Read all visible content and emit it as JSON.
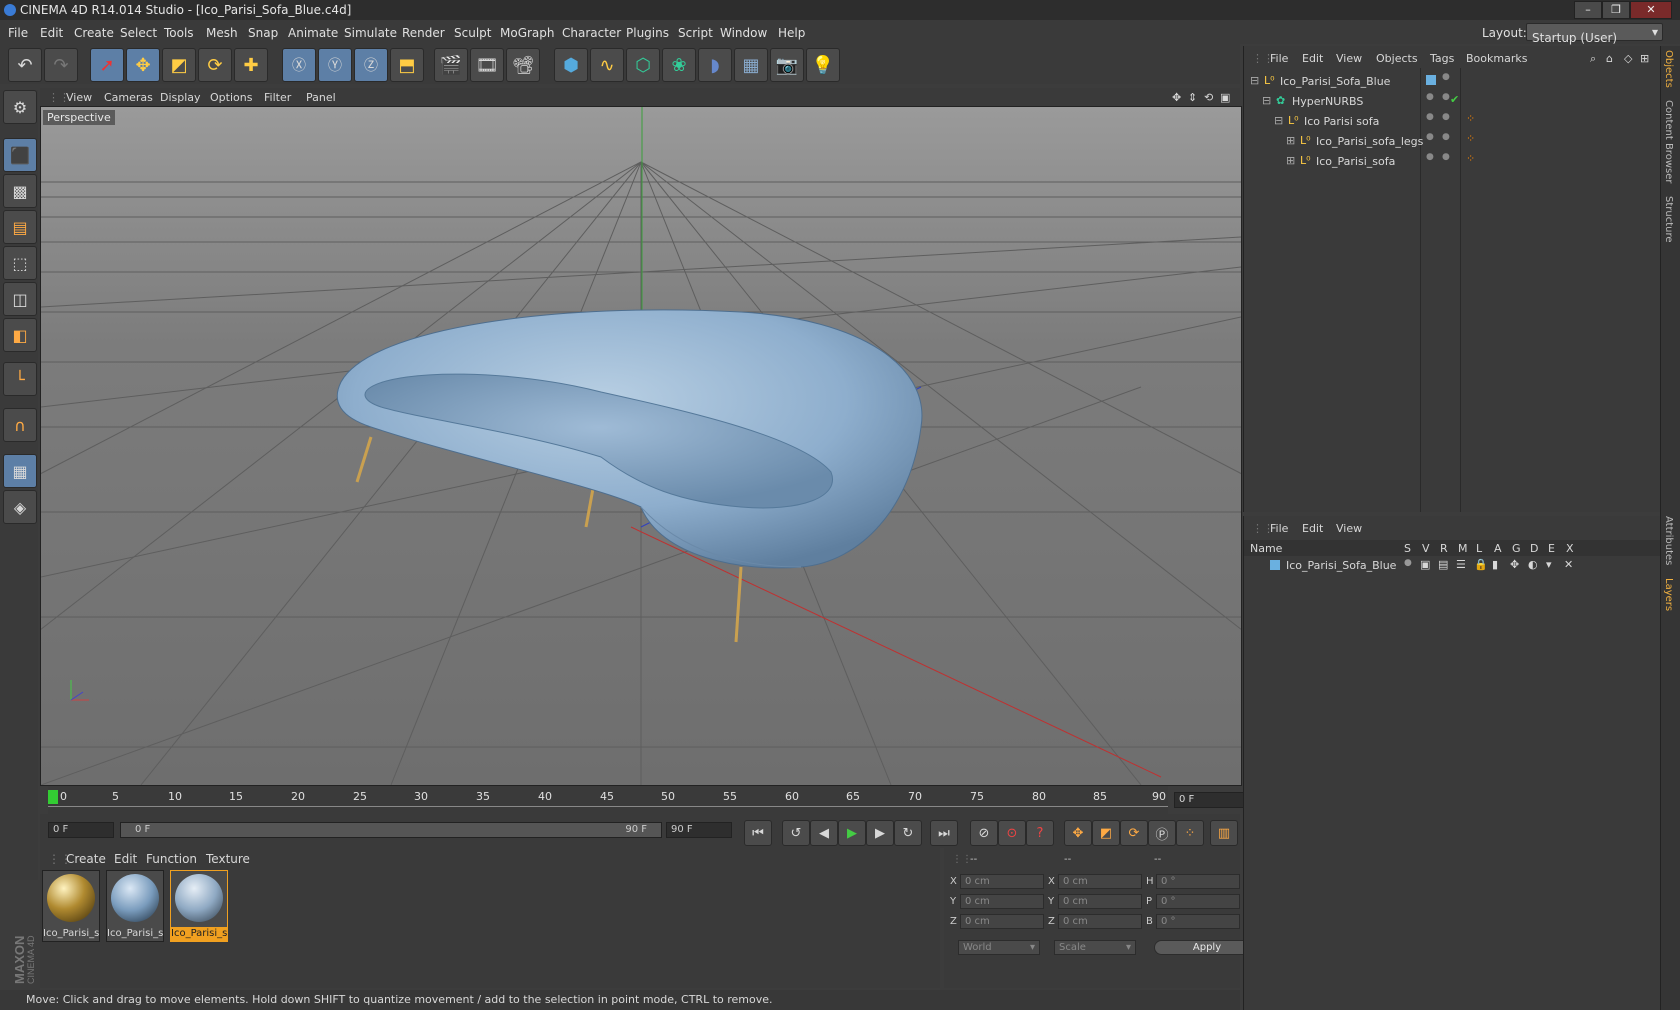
{
  "window": {
    "title": "CINEMA 4D R14.014 Studio - [Ico_Parisi_Sofa_Blue.c4d]"
  },
  "menubar": {
    "items": [
      "File",
      "Edit",
      "Create",
      "Select",
      "Tools",
      "Mesh",
      "Snap",
      "Animate",
      "Simulate",
      "Render",
      "Sculpt",
      "MoGraph",
      "Character",
      "Plugins",
      "Script",
      "Window",
      "Help"
    ],
    "layout_label": "Layout:",
    "layout_value": "Startup (User)"
  },
  "viewport": {
    "menu": [
      "View",
      "Cameras",
      "Display",
      "Options",
      "Filter",
      "Panel"
    ],
    "label": "Perspective"
  },
  "timeline": {
    "ticks": [
      "0",
      "5",
      "10",
      "15",
      "20",
      "25",
      "30",
      "35",
      "40",
      "45",
      "50",
      "55",
      "60",
      "65",
      "70",
      "75",
      "80",
      "85",
      "90"
    ],
    "current_frame": "0 F"
  },
  "transport": {
    "start": "0 F",
    "range_start": "0 F",
    "range_end": "90 F",
    "end": "90 F"
  },
  "materials": {
    "menu": [
      "Create",
      "Edit",
      "Function",
      "Texture"
    ],
    "items": [
      "Ico_Parisi_s",
      "Ico_Parisi_s",
      "Ico_Parisi_s"
    ]
  },
  "coords": {
    "headers": [
      "--",
      "--",
      "--"
    ],
    "rows": [
      {
        "a": "X",
        "av": "0 cm",
        "b": "X",
        "bv": "0 cm",
        "c": "H",
        "cv": "0 °"
      },
      {
        "a": "Y",
        "av": "0 cm",
        "b": "Y",
        "bv": "0 cm",
        "c": "P",
        "cv": "0 °"
      },
      {
        "a": "Z",
        "av": "0 cm",
        "b": "Z",
        "bv": "0 cm",
        "c": "B",
        "cv": "0 °"
      }
    ],
    "mode": "World",
    "scale": "Scale",
    "apply": "Apply"
  },
  "status": "Move: Click and drag to move elements. Hold down SHIFT to quantize movement / add to the selection in point mode, CTRL to remove.",
  "objects": {
    "menu": [
      "File",
      "Edit",
      "View",
      "Objects",
      "Tags",
      "Bookmarks"
    ],
    "tree": [
      "Ico_Parisi_Sofa_Blue",
      "HyperNURBS",
      "Ico Parisi sofa",
      "Ico_Parisi_sofa_legs",
      "Ico_Parisi_sofa"
    ]
  },
  "layers": {
    "menu": [
      "File",
      "Edit",
      "View"
    ],
    "name_header": "Name",
    "cols": [
      "S",
      "V",
      "R",
      "M",
      "L",
      "A",
      "G",
      "D",
      "E",
      "X"
    ],
    "row": "Ico_Parisi_Sofa_Blue"
  },
  "right_tabs": [
    "Objects",
    "Content Browser",
    "Structure",
    "Attributes",
    "Layers"
  ],
  "brand": "MAXON CINEMA 4D"
}
